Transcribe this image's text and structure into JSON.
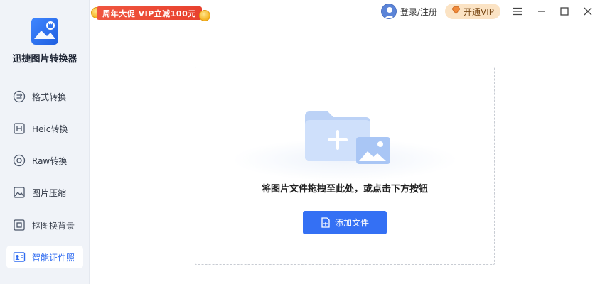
{
  "app": {
    "title": "迅捷图片转换器"
  },
  "sidebar": {
    "items": [
      {
        "label": "格式转换",
        "icon": "format-convert-icon"
      },
      {
        "label": "Heic转换",
        "icon": "heic-icon"
      },
      {
        "label": "Raw转换",
        "icon": "raw-icon"
      },
      {
        "label": "图片压缩",
        "icon": "image-compress-icon"
      },
      {
        "label": "抠图换背景",
        "icon": "cutout-icon"
      },
      {
        "label": "智能证件照",
        "icon": "id-photo-icon"
      }
    ],
    "active_index": 5
  },
  "topbar": {
    "promo_text": "周年大促 VIP立减100元",
    "login_text": "登录/注册",
    "vip_label": "开通VIP"
  },
  "main": {
    "drop_hint": "将图片文件拖拽至此处，或点击下方按钮",
    "add_button_label": "添加文件"
  },
  "colors": {
    "accent": "#3470f4",
    "sidebar_bg": "#f0f3f8",
    "promo_red": "#e8412e",
    "vip_bg": "#fbe3c4"
  }
}
